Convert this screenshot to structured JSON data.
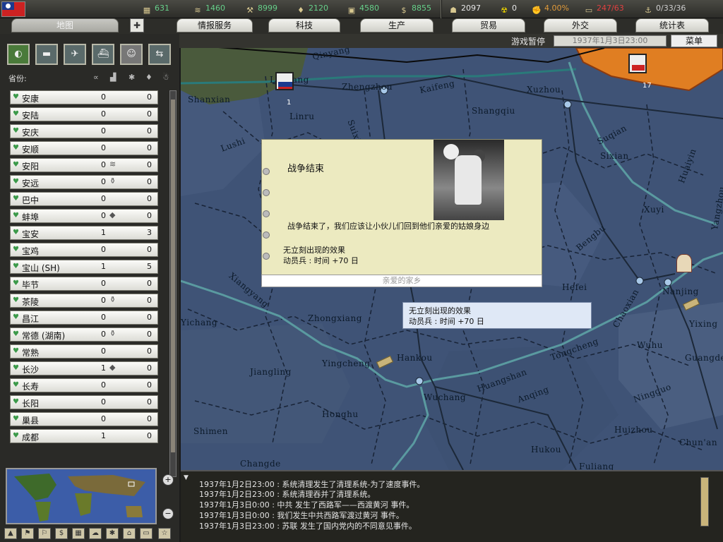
{
  "resources": [
    {
      "icon": "supplies-icon",
      "value": "631",
      "color": "green"
    },
    {
      "icon": "metal-icon",
      "value": "1460",
      "color": "green"
    },
    {
      "icon": "energy-icon",
      "value": "8999",
      "color": "green"
    },
    {
      "icon": "oil-icon",
      "value": "2120",
      "color": "green"
    },
    {
      "icon": "rare-materials-icon",
      "value": "4580",
      "color": "green"
    },
    {
      "icon": "money-icon",
      "value": "8855",
      "color": "green"
    },
    {
      "icon": "manpower-icon",
      "value": "2097",
      "color": "white"
    },
    {
      "icon": "nuclear-icon",
      "value": "0",
      "color": "white"
    },
    {
      "icon": "dissent-icon",
      "value": "4.00%",
      "color": "orange"
    },
    {
      "icon": "transport-icon",
      "value": "247/63",
      "color": "red"
    },
    {
      "icon": "escort-icon",
      "value": "0/33/36",
      "color": "grey"
    }
  ],
  "tabs": [
    "地图",
    "情报服务",
    "科技",
    "生产",
    "贸易",
    "外交",
    "统计表"
  ],
  "status": {
    "paused": "游戏暂停",
    "date": "1937年1月3日23:00",
    "menu": "菜单"
  },
  "left": {
    "provinces_label": "省份:",
    "provinces": [
      {
        "name": "安康",
        "v1": "0",
        "v2": "0",
        "icon": ""
      },
      {
        "name": "安陆",
        "v1": "0",
        "v2": "0",
        "icon": ""
      },
      {
        "name": "安庆",
        "v1": "0",
        "v2": "0",
        "icon": ""
      },
      {
        "name": "安顺",
        "v1": "0",
        "v2": "0",
        "icon": ""
      },
      {
        "name": "安阳",
        "v1": "0",
        "v2": "0",
        "icon": "≋"
      },
      {
        "name": "安远",
        "v1": "0",
        "v2": "0",
        "icon": "⚱"
      },
      {
        "name": "巴中",
        "v1": "0",
        "v2": "0",
        "icon": ""
      },
      {
        "name": "蚌埠",
        "v1": "0",
        "v2": "0",
        "icon": "◆"
      },
      {
        "name": "宝安",
        "v1": "1",
        "v2": "3",
        "icon": ""
      },
      {
        "name": "宝鸡",
        "v1": "0",
        "v2": "0",
        "icon": ""
      },
      {
        "name": "宝山 (SH)",
        "v1": "1",
        "v2": "5",
        "icon": ""
      },
      {
        "name": "毕节",
        "v1": "0",
        "v2": "0",
        "icon": ""
      },
      {
        "name": "茶陵",
        "v1": "0",
        "v2": "0",
        "icon": "⚱"
      },
      {
        "name": "昌江",
        "v1": "0",
        "v2": "0",
        "icon": ""
      },
      {
        "name": "常德 (湖南)",
        "v1": "0",
        "v2": "0",
        "icon": "⚱"
      },
      {
        "name": "常熟",
        "v1": "0",
        "v2": "0",
        "icon": ""
      },
      {
        "name": "长沙",
        "v1": "1",
        "v2": "0",
        "icon": "◆"
      },
      {
        "name": "长寿",
        "v1": "0",
        "v2": "0",
        "icon": ""
      },
      {
        "name": "长阳",
        "v1": "0",
        "v2": "0",
        "icon": ""
      },
      {
        "name": "巢县",
        "v1": "0",
        "v2": "0",
        "icon": ""
      },
      {
        "name": "成都",
        "v1": "1",
        "v2": "0",
        "icon": ""
      }
    ]
  },
  "map": {
    "labels": [
      {
        "t": "Qinyang"
      },
      {
        "t": "Luoyang"
      },
      {
        "t": "Zhengzhou"
      },
      {
        "t": "Kaifeng"
      },
      {
        "t": "Xuzhou"
      },
      {
        "t": "Shanxian"
      },
      {
        "t": "Linru"
      },
      {
        "t": "Shangqiu"
      },
      {
        "t": "Lushi"
      },
      {
        "t": "Suqian"
      },
      {
        "t": "Sixian"
      },
      {
        "t": "Huaiyin"
      },
      {
        "t": "Xuyi"
      },
      {
        "t": "Bengbu"
      },
      {
        "t": "Hefei"
      },
      {
        "t": "Nanjing"
      },
      {
        "t": "Yichang"
      },
      {
        "t": "Zhongxiang"
      },
      {
        "t": "Hankou"
      },
      {
        "t": "Wuchang"
      },
      {
        "t": "Jiangling"
      },
      {
        "t": "Yingcheng"
      },
      {
        "t": "Honghu"
      },
      {
        "t": "Anqing"
      },
      {
        "t": "Wuhu"
      },
      {
        "t": "Huizhou"
      },
      {
        "t": "Ningguo"
      },
      {
        "t": "Shimen"
      },
      {
        "t": "Changde"
      },
      {
        "t": "Guangde"
      },
      {
        "t": "Yixing"
      },
      {
        "t": "Chaoxian"
      },
      {
        "t": "Tongcheng"
      },
      {
        "t": "Huangshan"
      },
      {
        "t": "Hukou"
      },
      {
        "t": "Fuliang"
      },
      {
        "t": "Chun'an"
      },
      {
        "t": "Yangzhou"
      },
      {
        "t": "Suixian"
      },
      {
        "t": "Xiangyang"
      }
    ],
    "unit_counts": [
      "1",
      "17"
    ]
  },
  "event": {
    "title": "战争结束",
    "description": "战争结束了，我们应该让小伙儿们回到他们亲爱的姑娘身边",
    "effect_header": "无立刻出现的效果",
    "effect_line": "动员兵 : 时间  +70 日",
    "option": "亲爱的家乡"
  },
  "tooltip": {
    "line1": "无立刻出现的效果",
    "line2": "动员兵 : 时间  +70 日"
  },
  "log": [
    "1937年1月2日23:00  : 系统清理发生了清理系统-为了速度事件。",
    "1937年1月2日23:00  : 系统清理吞并了清理系统。",
    "1937年1月3日0:00  : 中共 发生了西路军——西渡黄河 事件。",
    "1937年1月3日0:00  : 我们发生中共西路军渡过黄河 事件。",
    "1937年1月3日23:00  : 苏联 发生了国内党内的不同意见事件。"
  ]
}
